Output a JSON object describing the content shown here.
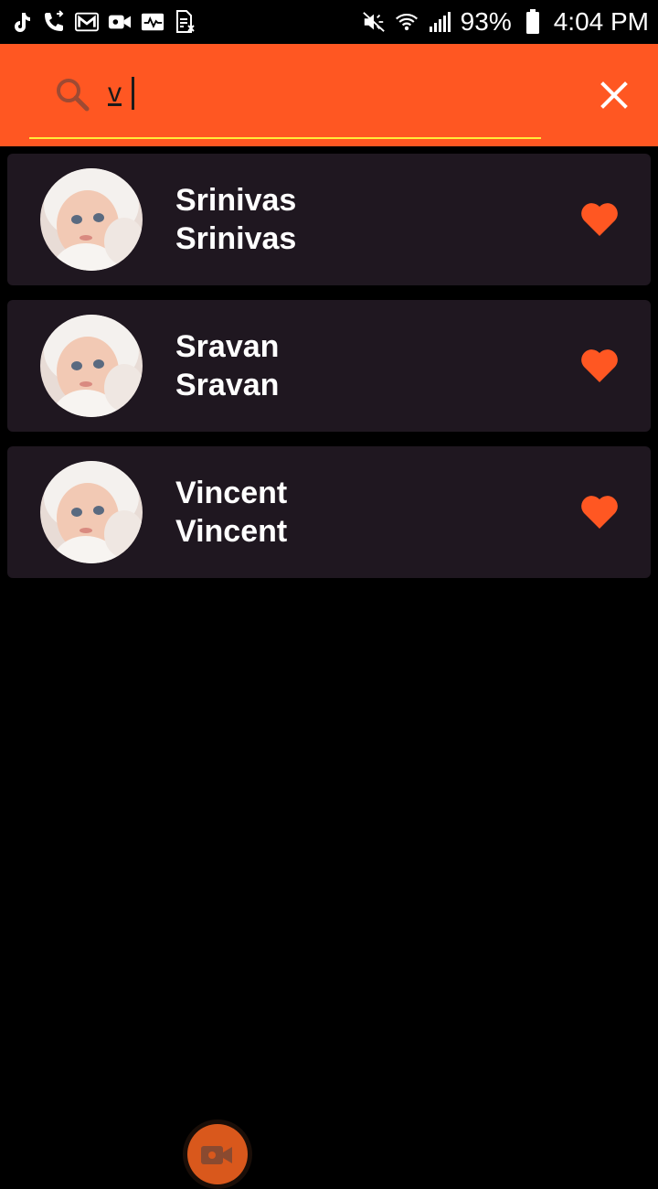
{
  "status_bar": {
    "left_icons": [
      "tiktok-icon",
      "phone-forward-icon",
      "gmail-icon",
      "video-icon",
      "activity-icon",
      "sim-icon"
    ],
    "right_icons": [
      "mute-icon",
      "wifi-icon",
      "signal-icon",
      "battery-icon"
    ],
    "battery": "93%",
    "time": "4:04 PM"
  },
  "search": {
    "value": "v",
    "placeholder": ""
  },
  "colors": {
    "accent": "#ff5722",
    "card_bg": "#1f1720",
    "heart": "#ff5722",
    "underline": "#ffeb3b"
  },
  "contacts": [
    {
      "first": "Srinivas",
      "last": "Srinivas"
    },
    {
      "first": "Sravan",
      "last": "Sravan"
    },
    {
      "first": "Vincent",
      "last": "Vincent"
    }
  ]
}
